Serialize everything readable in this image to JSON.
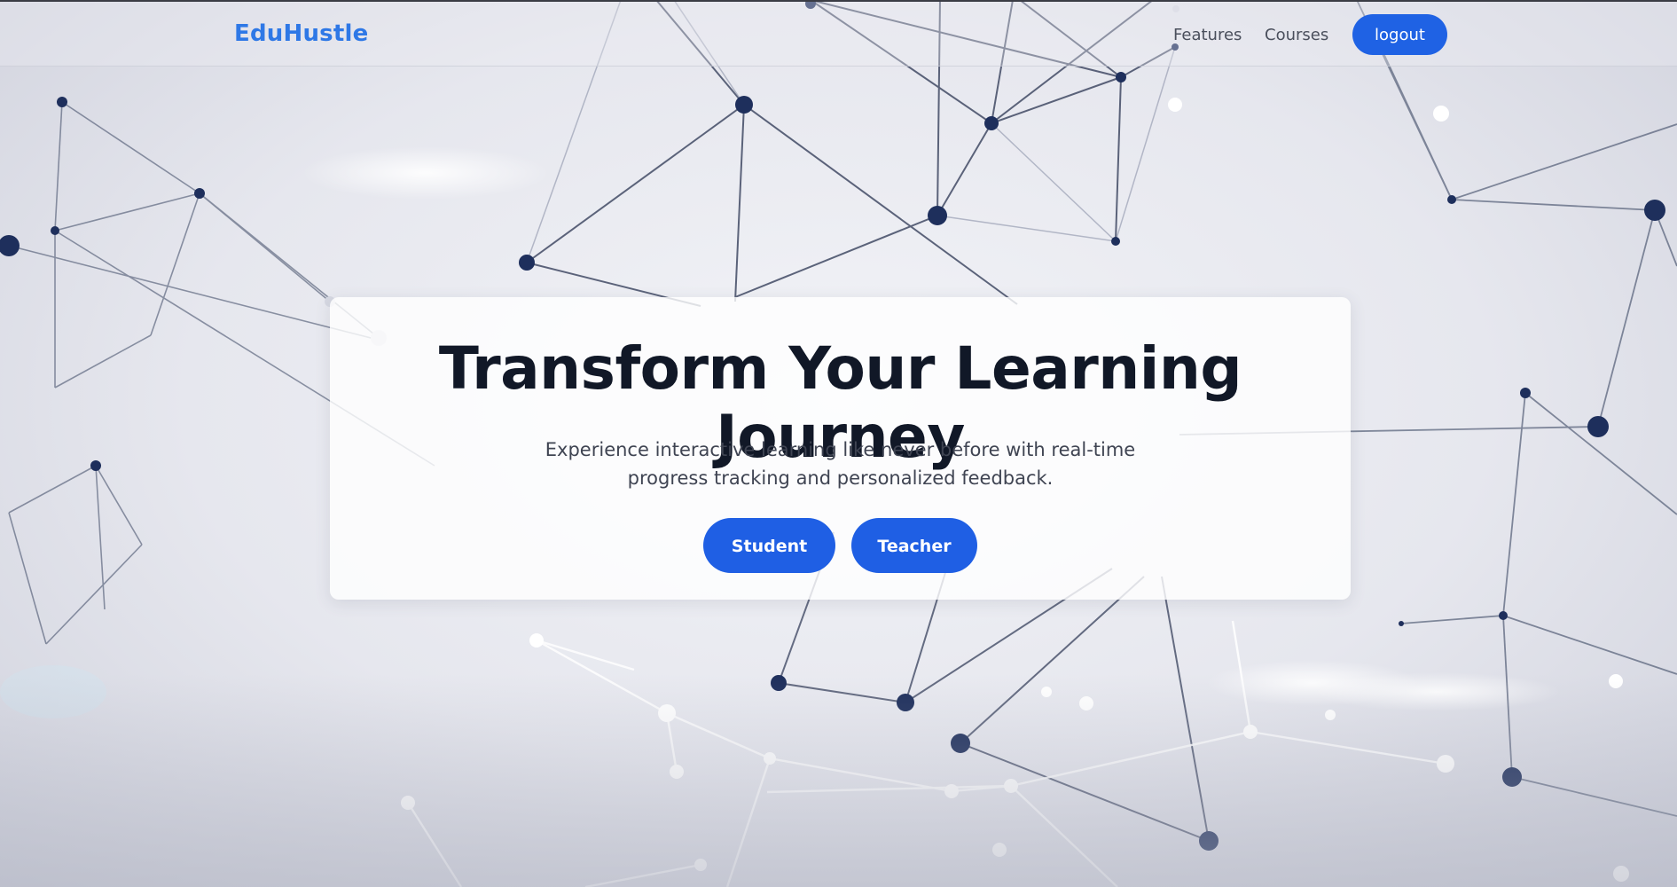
{
  "brand": {
    "name": "EduHustle"
  },
  "nav": {
    "links": [
      "Features",
      "Courses"
    ],
    "logout_label": "logout"
  },
  "hero": {
    "title": "Transform Your Learning Journey",
    "subtitle": "Experience interactive learning like never before with real-time progress tracking and personalized feedback.",
    "buttons": [
      "Student",
      "Teacher"
    ]
  },
  "colors": {
    "brand": "#2e78e6",
    "primary_button": "#1f62e4",
    "title_text": "#111827",
    "page_background": "#e6e7ee",
    "network_node": "#1e2f5c"
  },
  "background": {
    "decoration": "network-graph"
  }
}
